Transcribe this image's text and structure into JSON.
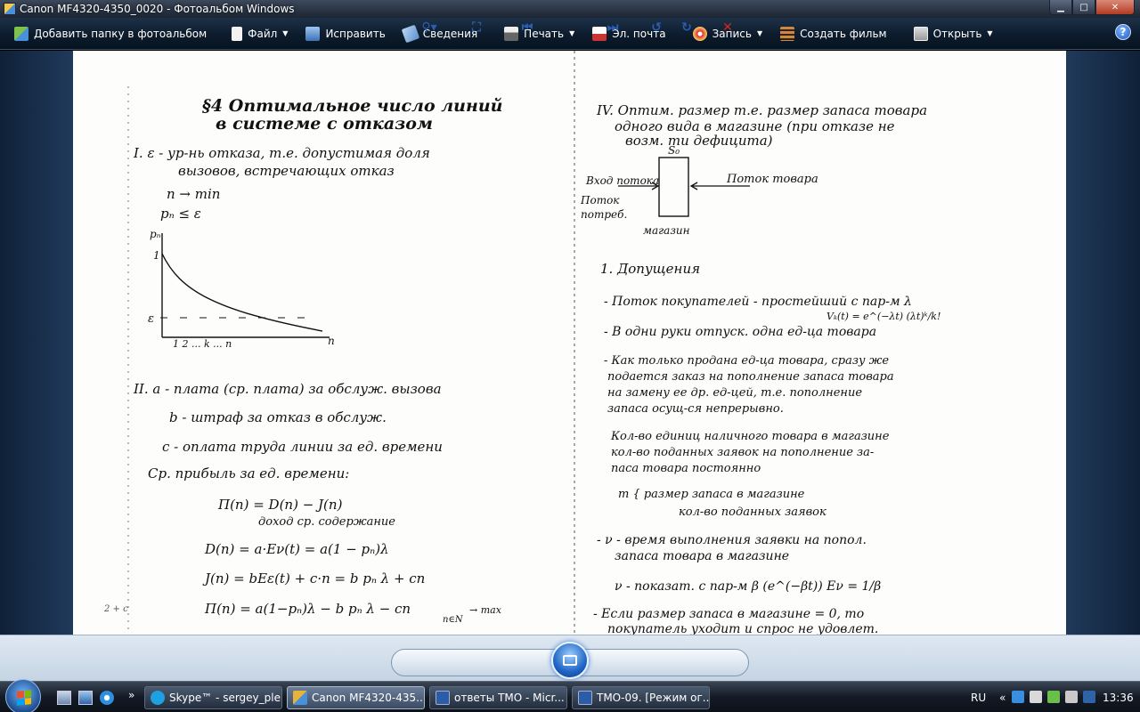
{
  "window": {
    "title": "Canon MF4320-4350_0020 - Фотоальбом Windows"
  },
  "toolbar": {
    "items": [
      {
        "label": "Добавить папку в фотоальбом",
        "icon": "add-folder-icon",
        "dropdown": false
      },
      {
        "label": "Файл",
        "icon": "file-icon",
        "dropdown": true
      },
      {
        "label": "Исправить",
        "icon": "fix-icon",
        "dropdown": false
      },
      {
        "label": "Сведения",
        "icon": "info-icon",
        "dropdown": false
      },
      {
        "label": "Печать",
        "icon": "print-icon",
        "dropdown": true
      },
      {
        "label": "Эл. почта",
        "icon": "email-icon",
        "dropdown": false
      },
      {
        "label": "Запись",
        "icon": "burn-icon",
        "dropdown": true
      },
      {
        "label": "Создать фильм",
        "icon": "movie-icon",
        "dropdown": false
      },
      {
        "label": "Открыть",
        "icon": "open-icon",
        "dropdown": true
      }
    ],
    "help": "?"
  },
  "document": {
    "left": {
      "heading_1": "§4 Оптимальное число линий",
      "heading_2": "в системе с отказом",
      "s1_line1": "I. ε - ур-нь отказа, т.е. допустимая доля",
      "s1_line2": "вызовов, встречающих отказ",
      "cond1": "n → min",
      "cond2": "pₙ ≤ ε",
      "graph_ylabel": "pₙ",
      "graph_y1": "1",
      "graph_eps": "ε",
      "graph_xticks": "1   2  ...  k  ...  n",
      "graph_xlabel": "n",
      "s2_line1": "II.  a - плата (ср. плата) за обслуж. вызова",
      "s2_line2": "b - штраф за отказ в обслуж.",
      "s2_line3": "c - оплата труда линии за ед. времени",
      "s2_line4": "Ср. прибыль за ед. времени:",
      "f1": "Π(n) = D(n) − J(n)",
      "f1_note": "доход      ср. содержание",
      "f2": "D(n) = a·Eν(t) = a(1 − pₙ)λ",
      "f3": "J(n) = bEε(t) + c·n = b pₙ λ + cn",
      "f4": "Π(n) = a(1−pₙ)λ − b pₙ λ − cn",
      "f4_note": "→ max",
      "f4_sub": "n∈N",
      "margin_note": "2 + c"
    },
    "right": {
      "heading_1": "IV. Оптим. размер т.е. размер запаса товара",
      "heading_2": "одного вида в магазине (при отказе не",
      "heading_3": "возм. ти дефицита)",
      "diagram_top": "S₀",
      "diagram_left_1": "Вход потока",
      "diagram_left_2": "Поток",
      "diagram_left_3": "потреб.",
      "diagram_right": "Поток товара",
      "diagram_bottom": "магазин",
      "assump_title": "1. Допущения",
      "a1": "- Поток покупателей - простейший с пар-м λ",
      "a1_formula": "Vₖ(t) = e^(−λt) (λt)ᵏ/k!",
      "a2": "- В одни руки отпуск. одна ед-ца товара",
      "a3_1": "- Как только продана ед-ца товара, сразу же",
      "a3_2": "подается заказ на пополнение запаса товара",
      "a3_3": "на замену ее др. ед-цей, т.е. пополнение",
      "a3_4": "запаса осущ-ся непрерывно.",
      "a4_1": "Кол-во единиц наличного товара в магазине",
      "a4_2": "кол-во поданных заявок на пополнение за-",
      "a4_3": "паса товара постоянно",
      "a5_1": "m { размер запаса в магазине",
      "a5_2": "кол-во поданных заявок",
      "a6_1": "- ν - время выполнения заявки на попол.",
      "a6_2": "запаса товара в магазине",
      "a7": "ν - показат. с пар-м β   (e^(−βt))  Eν = 1/β",
      "a8_1": "- Если размер запаса в магазине = 0, то",
      "a8_2": "покупатель уходит и спрос не удовлет."
    }
  },
  "player": {
    "buttons": [
      "zoom",
      "actual-size",
      "previous",
      "slideshow",
      "next",
      "rotate-ccw",
      "rotate-cw",
      "delete"
    ]
  },
  "taskbar": {
    "tasks": [
      {
        "label": "Skype™ - sergey_ple...",
        "active": false,
        "color": "#1fa0e0"
      },
      {
        "label": "Canon MF4320-435...",
        "active": true,
        "color": "#e8b33a"
      },
      {
        "label": "ответы ТМО - Micr...",
        "active": false,
        "color": "#2b5ca8"
      },
      {
        "label": "ТМО-09. [Режим ог...",
        "active": false,
        "color": "#2b5ca8"
      }
    ],
    "lang": "RU",
    "chevron": "«",
    "clock": "13:36"
  }
}
